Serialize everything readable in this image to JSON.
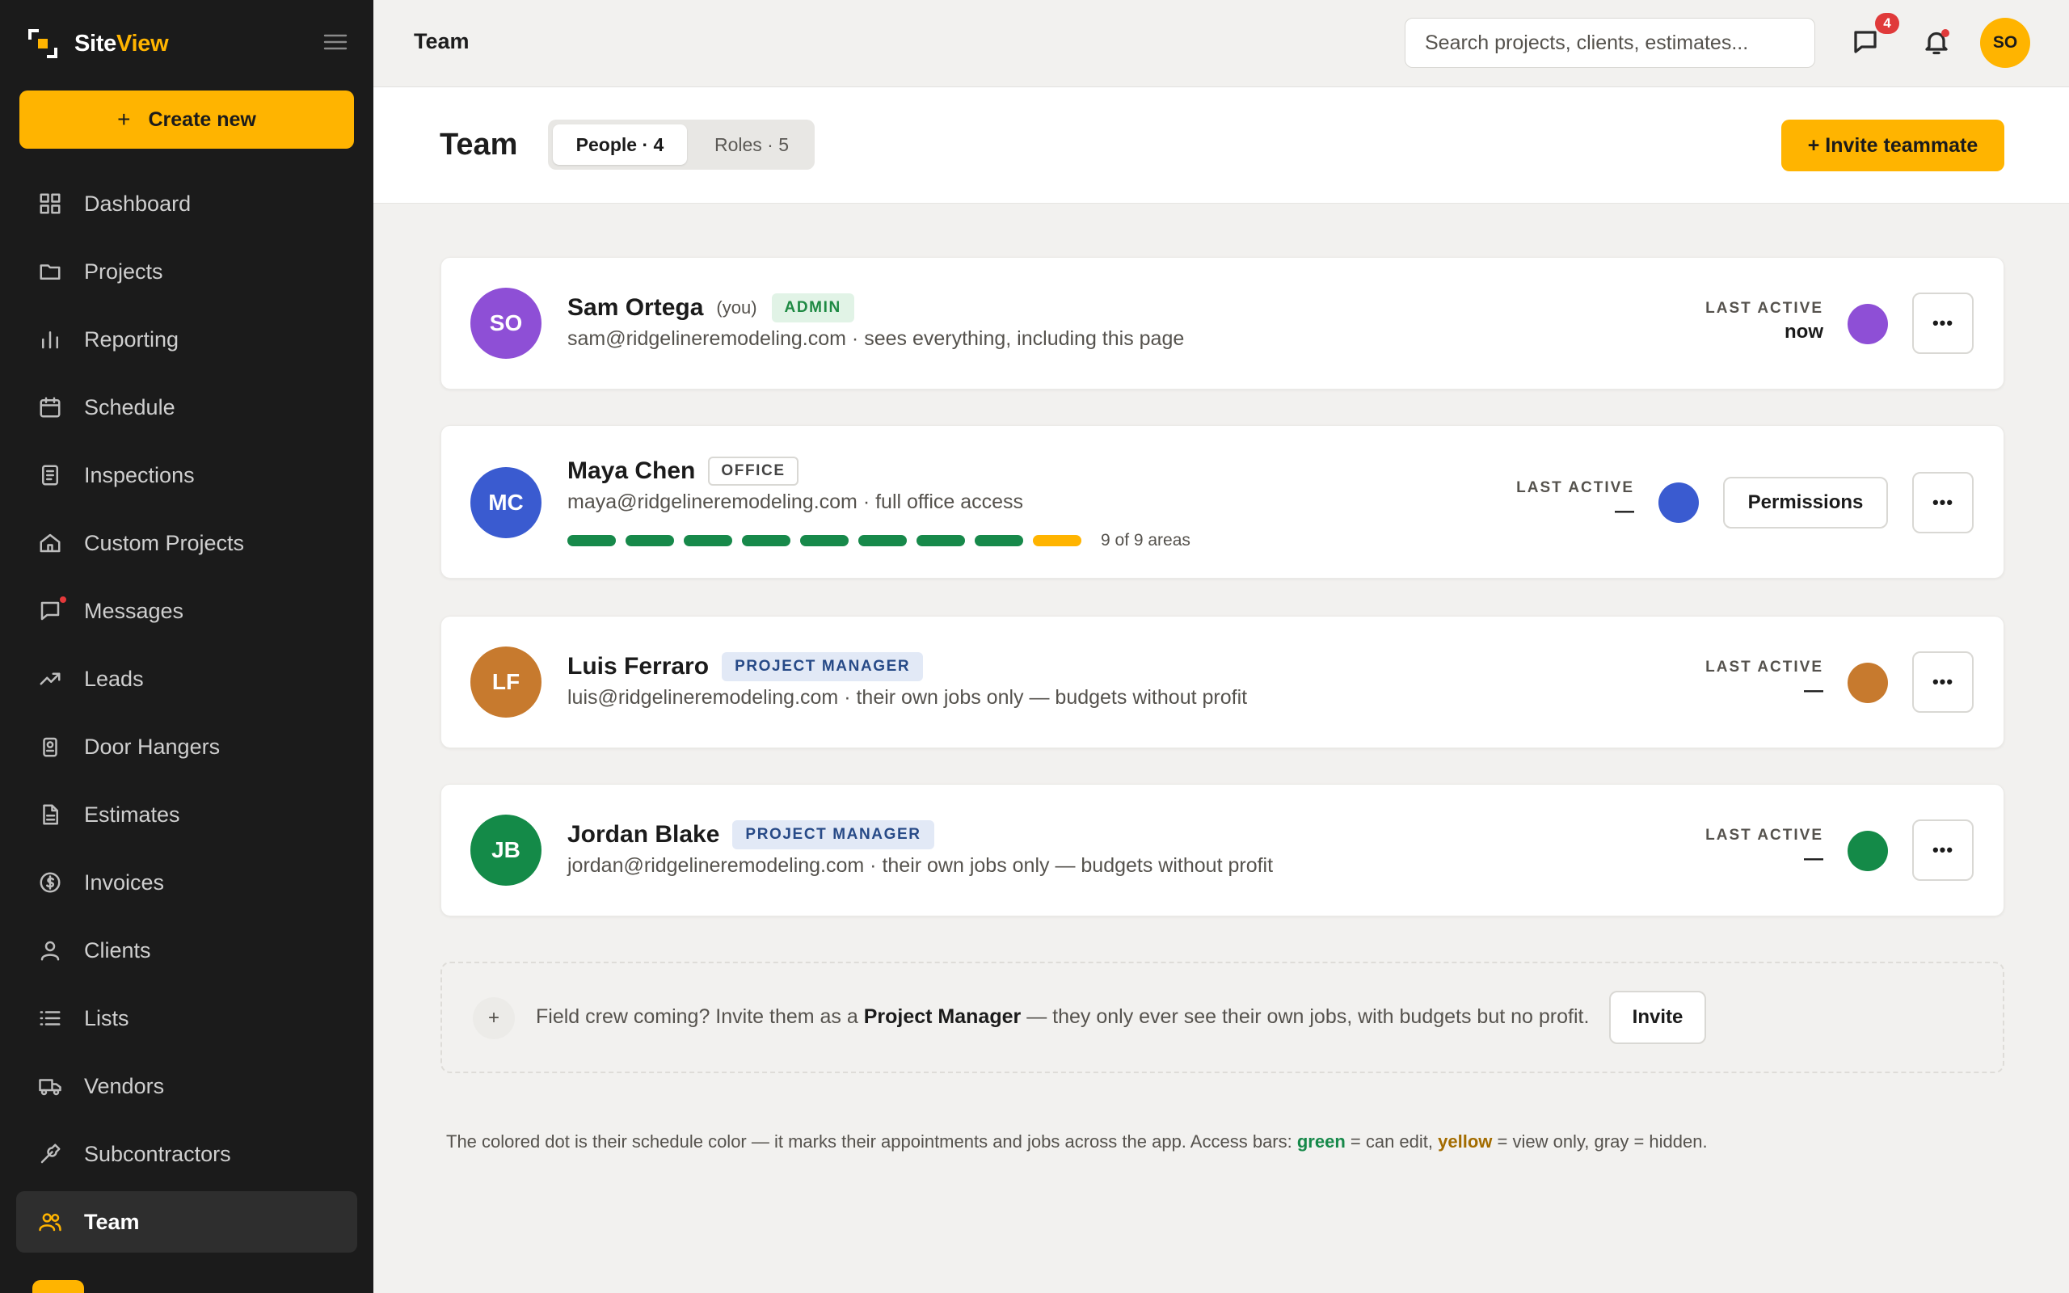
{
  "app": {
    "brand_part1": "Site",
    "brand_part2": "View",
    "create_label": "Create new"
  },
  "sidebar": {
    "items": [
      {
        "label": "Dashboard",
        "icon": "dashboard-icon"
      },
      {
        "label": "Projects",
        "icon": "folder-icon"
      },
      {
        "label": "Reporting",
        "icon": "bar-chart-icon"
      },
      {
        "label": "Schedule",
        "icon": "calendar-icon"
      },
      {
        "label": "Inspections",
        "icon": "clipboard-icon"
      },
      {
        "label": "Custom Projects",
        "icon": "home-icon"
      },
      {
        "label": "Messages",
        "icon": "message-icon"
      },
      {
        "label": "Leads",
        "icon": "trending-up-icon"
      },
      {
        "label": "Door Hangers",
        "icon": "door-hanger-icon"
      },
      {
        "label": "Estimates",
        "icon": "document-icon"
      },
      {
        "label": "Invoices",
        "icon": "dollar-icon"
      },
      {
        "label": "Clients",
        "icon": "user-icon"
      },
      {
        "label": "Lists",
        "icon": "list-icon"
      },
      {
        "label": "Vendors",
        "icon": "truck-icon"
      },
      {
        "label": "Subcontractors",
        "icon": "wrench-icon"
      },
      {
        "label": "Team",
        "icon": "team-icon"
      }
    ],
    "active": "Team"
  },
  "topbar": {
    "title": "Team",
    "search_placeholder": "Search projects, clients, estimates...",
    "messages_badge": "4",
    "user_initials": "SO"
  },
  "page": {
    "title": "Team",
    "tab_people": "People · 4",
    "tab_roles": "Roles · 5",
    "invite_label": "+ Invite teammate"
  },
  "members": [
    {
      "initials": "SO",
      "name": "Sam Ortega",
      "you": "(you)",
      "role": "ADMIN",
      "email_line": "sam@ridgelineremodeling.com · sees everything, including this page",
      "last_active_label": "LAST ACTIVE",
      "last_active": "now",
      "color": "#8e4fd6"
    },
    {
      "initials": "MC",
      "name": "Maya Chen",
      "role": "OFFICE",
      "email_line": "maya@ridgelineremodeling.com · full office access",
      "last_active_label": "LAST ACTIVE",
      "last_active": "—",
      "color": "#3a5bd0",
      "access_bars": [
        "edit",
        "edit",
        "edit",
        "edit",
        "edit",
        "edit",
        "edit",
        "edit",
        "view"
      ],
      "access_label": "9 of 9 areas",
      "permissions_label": "Permissions"
    },
    {
      "initials": "LF",
      "name": "Luis Ferraro",
      "role": "PROJECT MANAGER",
      "email_line": "luis@ridgelineremodeling.com · their own jobs only — budgets without profit",
      "last_active_label": "LAST ACTIVE",
      "last_active": "—",
      "color": "#c77a2e"
    },
    {
      "initials": "JB",
      "name": "Jordan Blake",
      "role": "PROJECT MANAGER",
      "email_line": "jordan@ridgelineremodeling.com · their own jobs only — budgets without profit",
      "last_active_label": "LAST ACTIVE",
      "last_active": "—",
      "color": "#148a48"
    }
  ],
  "more_label": "•••",
  "invite_box": {
    "text_pre": "Field crew coming? Invite them as a ",
    "text_bold": "Project Manager",
    "text_post": " — they only ever see their own jobs, with budgets but no profit.",
    "button": "Invite"
  },
  "footnote": {
    "pre": "The colored dot is their schedule color — it marks their appointments and jobs across the app. Access bars: ",
    "green": "green",
    "mid": " = can edit, ",
    "yellow": "yellow",
    "post": " = view only, gray = hidden."
  },
  "colors": {
    "accent": "#ffb400",
    "sidebar_bg": "#1b1b1b",
    "edit": "#17894a",
    "view": "#ffb400"
  }
}
